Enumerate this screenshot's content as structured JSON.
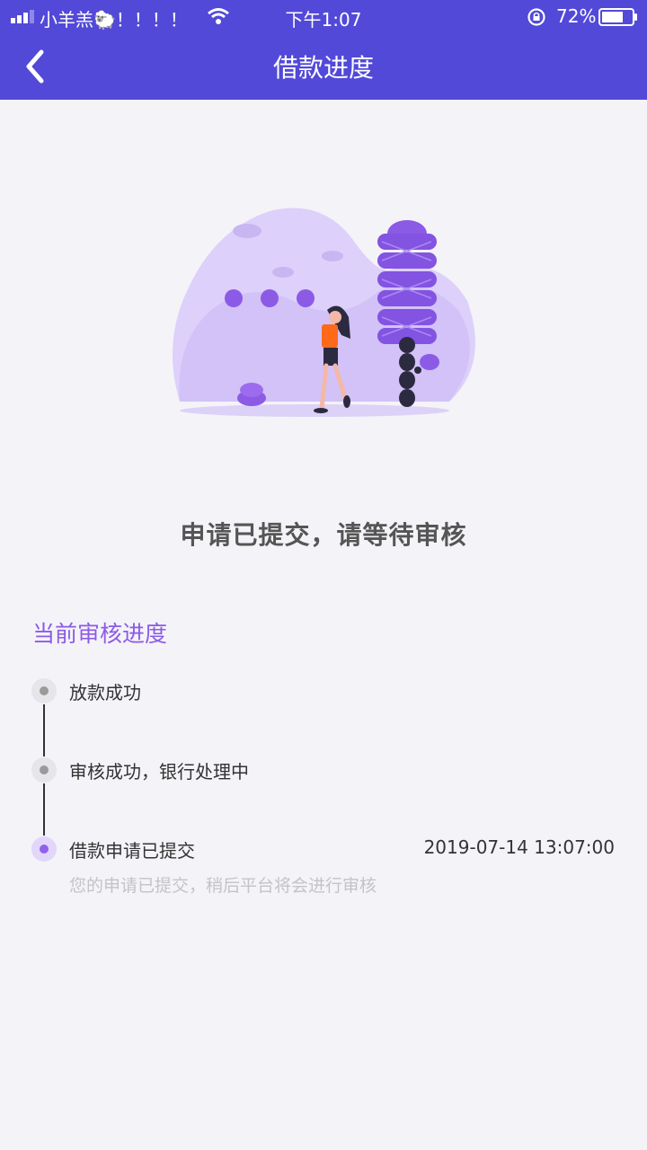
{
  "status_bar": {
    "carrier": "小羊羔🐑！！！！",
    "time": "下午1:07",
    "battery_percent": "72%",
    "battery_level": 0.72
  },
  "nav": {
    "title": "借款进度"
  },
  "headline": "申请已提交，请等待审核",
  "progress": {
    "section_title": "当前审核进度",
    "steps": [
      {
        "label": "放款成功",
        "state": "pending"
      },
      {
        "label": "审核成功，银行处理中",
        "state": "pending"
      },
      {
        "label": "借款申请已提交",
        "time": "2019-07-14 13:07:00",
        "description": "您的申请已提交，稍后平台将会进行审核",
        "state": "current"
      }
    ]
  },
  "colors": {
    "header_bg": "#5249d9",
    "accent_purple": "#8c5be6",
    "page_bg": "#f4f3f8"
  }
}
